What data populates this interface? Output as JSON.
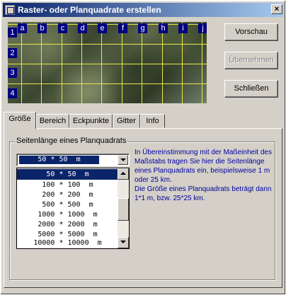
{
  "window": {
    "title": "Raster-  oder Planquadrate erstellen",
    "close_label": "×"
  },
  "preview": {
    "columns": [
      "a",
      "b",
      "c",
      "d",
      "e",
      "f",
      "g",
      "h",
      "i",
      "j"
    ],
    "rows": [
      "1",
      "2",
      "3",
      "4"
    ],
    "grid_color": "#e8e84a"
  },
  "buttons": {
    "preview": "Vorschau",
    "apply": "Übernehmen",
    "close": "Schließen"
  },
  "tabs": [
    "Größe",
    "Bereich",
    "Eckpunkte",
    "Gitter",
    "Info"
  ],
  "active_tab": "Größe",
  "size_tab": {
    "group_title": "Seitenlänge eines Planquadrats",
    "selected_value": "50 * 50  m",
    "options": [
      "50 * 50  m",
      "100 * 100  m",
      "200 * 200  m",
      "500 * 500  m",
      "1000 * 1000  m",
      "2000 * 2000  m",
      "5000 * 5000  m",
      "10000 * 10000  m"
    ],
    "info_line1": "In Übereinstimmung mit der Maßeinheit des Maßstabs tragen Sie hier die Seitenlänge eines Planquadrats ein, beispielsweise 1 m oder 25 km.",
    "info_line2": "Die Größe eines Planquadrats beträgt dann 1*1 m,  bzw. 25*25 km."
  },
  "colors": {
    "title_start": "#0a246a",
    "title_end": "#a6caf0",
    "selection": "#0a246a",
    "info_text": "#0000a0"
  }
}
